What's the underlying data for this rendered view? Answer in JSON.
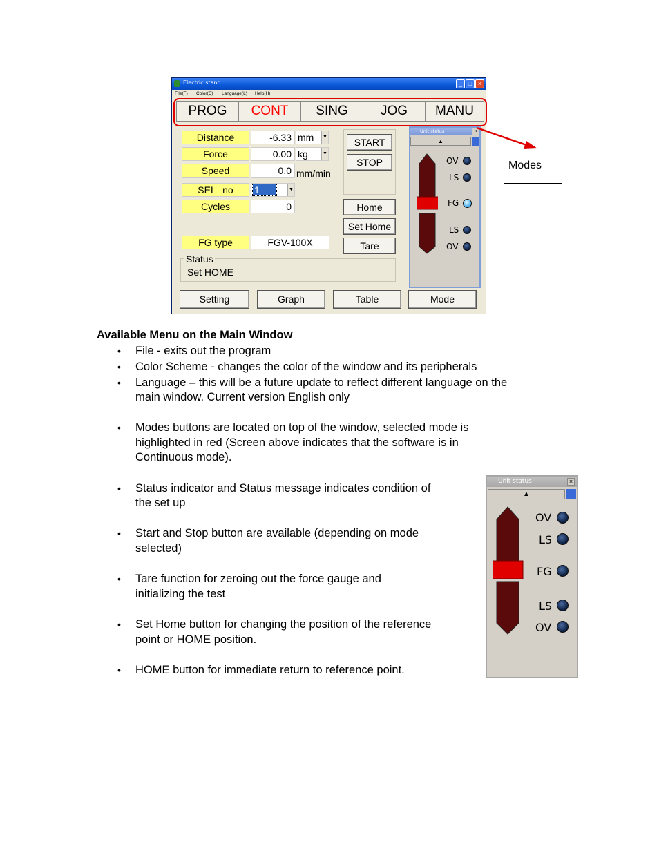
{
  "window": {
    "title": "Electric stand",
    "menu": [
      "File(F)",
      "Color(C)",
      "Language(L)",
      "Help(H)"
    ],
    "modes": [
      "PROG",
      "CONT",
      "SING",
      "JOG",
      "MANU"
    ],
    "selected_mode": "CONT",
    "fields": {
      "distance_label": "Distance",
      "distance_value": "-6.33",
      "distance_unit": "mm",
      "force_label": "Force",
      "force_value": "0.00",
      "force_unit": "kg",
      "speed_label": "Speed",
      "speed_value": "0.0",
      "speed_unit": "mm/min",
      "sel_label": "SEL",
      "sel_no": "no",
      "sel_value": "1",
      "cycles_label": "Cycles",
      "cycles_value": "0",
      "fg_type_label": "FG type",
      "fg_type_value": "FGV-100X"
    },
    "buttons": {
      "start": "START",
      "stop": "STOP",
      "home": "Home",
      "set_home": "Set Home",
      "tare": "Tare",
      "setting": "Setting",
      "graph": "Graph",
      "table": "Table",
      "mode": "Mode"
    },
    "status": {
      "legend": "Status",
      "message": "Set HOME"
    }
  },
  "unit_status": {
    "title": "Unit status",
    "indicators": [
      "OV",
      "LS",
      "FG",
      "LS",
      "OV"
    ],
    "fg_lit": true
  },
  "callout": "Modes",
  "colors": {
    "mode_selected": "#ff0000",
    "label_bg": "#ffff80",
    "highlight": "#e00000",
    "slider_thumb": "#e00000",
    "slider_bar": "#5a0a0a"
  },
  "doc": {
    "heading": "Available Menu on the Main Window",
    "items": [
      "File  -  exits out the program",
      "Color Scheme  - changes the color of the window and its peripherals",
      "Language – this will be a future update to reflect different language on the",
      "main window.  Current version  English only",
      "Modes buttons are located on top of the window, selected mode is",
      "highlighted in red  (Screen above indicates that the software is in",
      "Continuous mode).",
      "Status indicator and Status message indicates condition of",
      "the set up",
      "Start and Stop button are available (depending on mode",
      "selected)",
      "Tare function for zeroing out the force gauge and",
      "initializing the test",
      "Set Home button for changing the position of the reference",
      "point or HOME position.",
      "HOME button for immediate return to reference point."
    ],
    "bullet": "•"
  }
}
